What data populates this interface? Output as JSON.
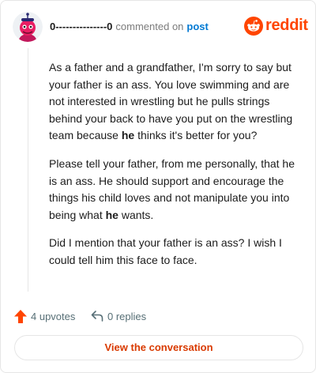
{
  "header": {
    "username": "0---------------0",
    "action_text": "commented on",
    "post_link": "post",
    "brand_name": "reddit",
    "brand_color": "#ff4500"
  },
  "comment": {
    "paragraphs": [
      [
        {
          "text": "As a father and a grandfather, I'm sorry to say but your father is an ass. You love swimming and are not interested in wrestling but he pulls strings behind your back to have you put on the wrestling team because ",
          "bold": false
        },
        {
          "text": "he",
          "bold": true
        },
        {
          "text": " thinks it's better for you?",
          "bold": false
        }
      ],
      [
        {
          "text": "Please tell your father, from me personally, that he is an ass. He should support and encourage the things his child loves and not manipulate you into being what ",
          "bold": false
        },
        {
          "text": "he",
          "bold": true
        },
        {
          "text": " wants.",
          "bold": false
        }
      ],
      [
        {
          "text": "Did I mention that your father is an ass? I wish I could tell him this face to face.",
          "bold": false
        }
      ]
    ]
  },
  "actions": {
    "upvotes": "4 upvotes",
    "replies": "0 replies",
    "upvote_icon": "upvote-arrow-icon",
    "reply_icon": "reply-arrow-icon",
    "upvote_color": "#ff4500"
  },
  "cta": {
    "label": "View the conversation",
    "color": "#d93a00"
  }
}
